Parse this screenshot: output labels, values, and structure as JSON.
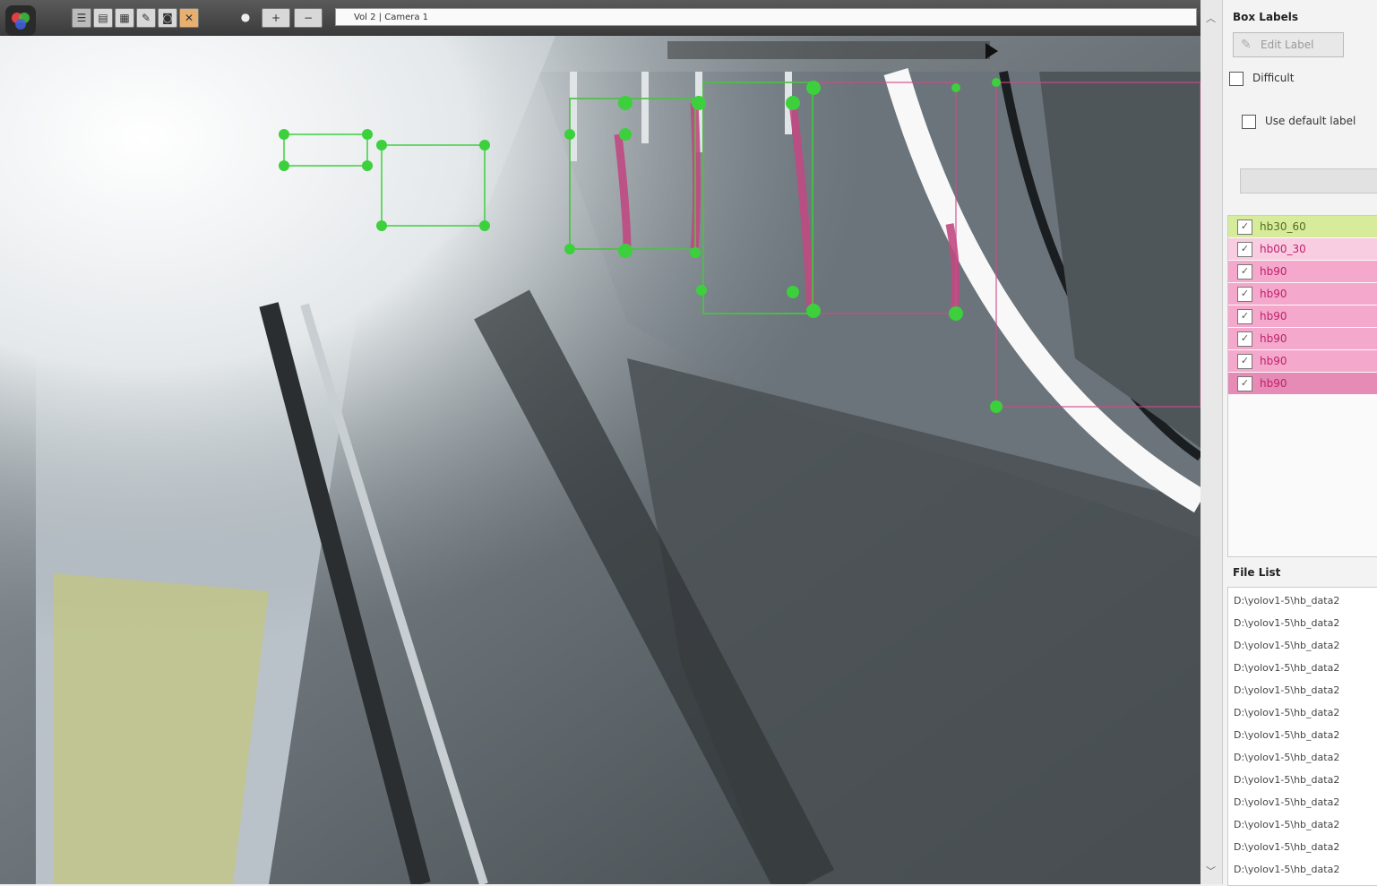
{
  "toolbar": {
    "title": "Vol 2 | Camera 1",
    "play_icon": "play-icon"
  },
  "box_labels": {
    "title": "Box Labels",
    "edit_button": "Edit Label",
    "difficult": "Difficult",
    "use_default": "Use default label"
  },
  "labels": [
    {
      "name": "hb30_60",
      "checked": "✓",
      "color": "#d6ec9a"
    },
    {
      "name": "hb00_30",
      "checked": "✓",
      "color": "#f8cde2"
    },
    {
      "name": "hb90",
      "checked": "✓",
      "color": "#f4a9cc"
    },
    {
      "name": "hb90",
      "checked": "✓",
      "color": "#f4a9cc"
    },
    {
      "name": "hb90",
      "checked": "✓",
      "color": "#f4a9cc"
    },
    {
      "name": "hb90",
      "checked": "✓",
      "color": "#f4a9cc"
    },
    {
      "name": "hb90",
      "checked": "✓",
      "color": "#f4a9cc"
    },
    {
      "name": "hb90",
      "checked": "✓",
      "color": "#e58bb6"
    }
  ],
  "file_list": {
    "title": "File List",
    "items": [
      "D:\\yolov1-5\\hb_data2",
      "D:\\yolov1-5\\hb_data2",
      "D:\\yolov1-5\\hb_data2",
      "D:\\yolov1-5\\hb_data2",
      "D:\\yolov1-5\\hb_data2",
      "D:\\yolov1-5\\hb_data2",
      "D:\\yolov1-5\\hb_data2",
      "D:\\yolov1-5\\hb_data2",
      "D:\\yolov1-5\\hb_data2",
      "D:\\yolov1-5\\hb_data2",
      "D:\\yolov1-5\\hb_data2",
      "D:\\yolov1-5\\hb_data2",
      "D:\\yolov1-5\\hb_data2"
    ]
  },
  "colors": {
    "box_green": "#3cd03c",
    "box_pink": "#d04a8a"
  }
}
